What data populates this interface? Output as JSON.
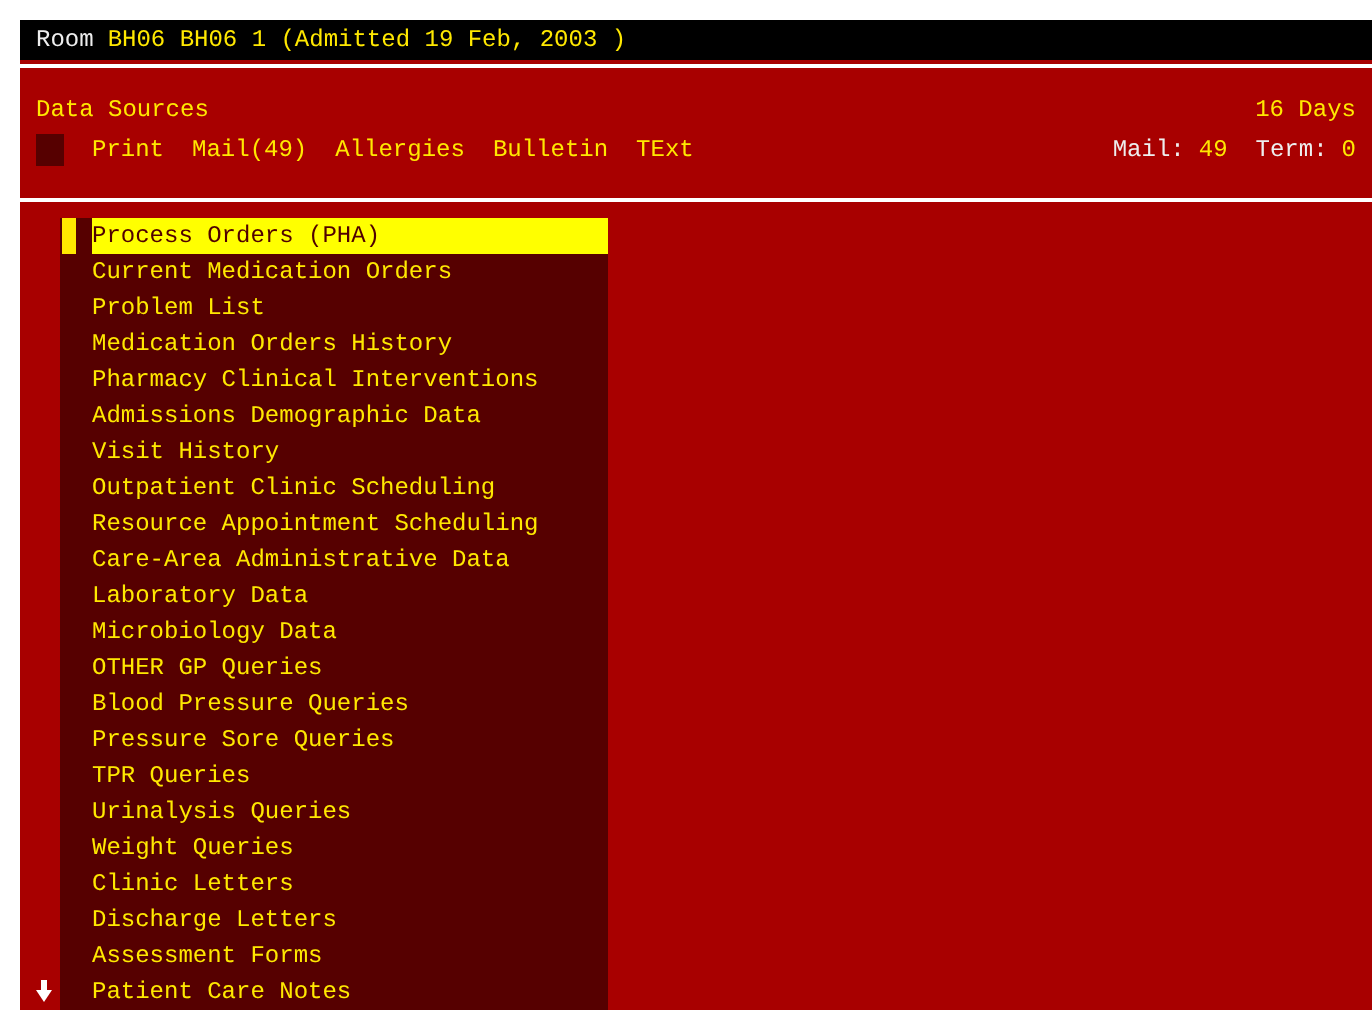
{
  "title_bar": {
    "label": "Room",
    "value": "BH06 BH06 1 (Admitted 19 Feb, 2003 )"
  },
  "header": {
    "title": "Data Sources",
    "days": "16 Days",
    "menu": [
      {
        "label": "Print"
      },
      {
        "label": "Mail(49)"
      },
      {
        "label": "Allergies"
      },
      {
        "label": "Bulletin"
      },
      {
        "label": "TExt"
      }
    ],
    "mail": {
      "label": "Mail:",
      "value": "49"
    },
    "term": {
      "label": "Term:",
      "value": "0"
    }
  },
  "list": {
    "items": [
      {
        "label": "Process Orders (PHA)",
        "selected": true
      },
      {
        "label": "Current Medication Orders",
        "selected": false
      },
      {
        "label": "Problem List",
        "selected": false
      },
      {
        "label": "Medication Orders History",
        "selected": false
      },
      {
        "label": "Pharmacy Clinical Interventions",
        "selected": false
      },
      {
        "label": "Admissions Demographic Data",
        "selected": false
      },
      {
        "label": "Visit History",
        "selected": false
      },
      {
        "label": "Outpatient Clinic Scheduling",
        "selected": false
      },
      {
        "label": "Resource Appointment Scheduling",
        "selected": false
      },
      {
        "label": "Care-Area Administrative Data",
        "selected": false
      },
      {
        "label": "Laboratory Data",
        "selected": false
      },
      {
        "label": "Microbiology Data",
        "selected": false
      },
      {
        "label": "OTHER GP Queries",
        "selected": false
      },
      {
        "label": "Blood Pressure Queries",
        "selected": false
      },
      {
        "label": "Pressure Sore Queries",
        "selected": false
      },
      {
        "label": "TPR Queries",
        "selected": false
      },
      {
        "label": "Urinalysis Queries",
        "selected": false
      },
      {
        "label": "Weight Queries",
        "selected": false
      },
      {
        "label": "Clinic Letters",
        "selected": false
      },
      {
        "label": "Discharge Letters",
        "selected": false
      },
      {
        "label": "Assessment Forms",
        "selected": false
      },
      {
        "label": "Patient Care Notes",
        "selected": false
      }
    ]
  }
}
